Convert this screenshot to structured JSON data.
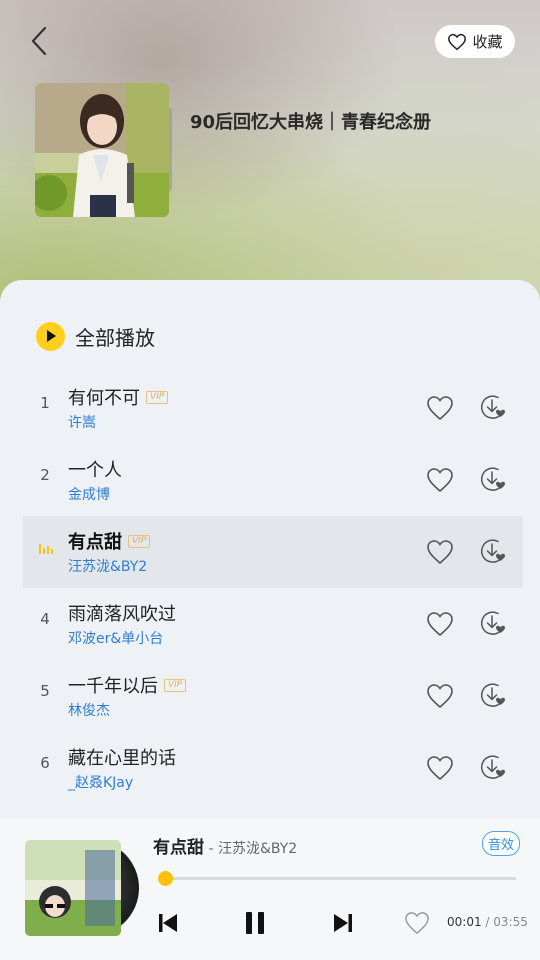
{
  "header": {
    "back_icon": "chevron-left-icon",
    "collect_label": "收藏",
    "collect_icon": "heart-outline-icon"
  },
  "playlist": {
    "title": "90后回忆大串烧｜青春纪念册"
  },
  "play_all": {
    "label": "全部播放",
    "icon": "play-circle-icon",
    "accent": "#ffcf1c"
  },
  "songs": [
    {
      "index": "1",
      "title": "有何不可",
      "vip": "VIP",
      "artist": "许嵩"
    },
    {
      "index": "2",
      "title": "一个人",
      "vip": "",
      "artist": "金成博"
    },
    {
      "index": "",
      "title": "有点甜",
      "vip": "VIP",
      "artist": "汪苏泷&BY2",
      "playing": true
    },
    {
      "index": "4",
      "title": "雨滴落风吹过",
      "vip": "",
      "artist": "邓波er&单小台"
    },
    {
      "index": "5",
      "title": "一千年以后",
      "vip": "VIP",
      "artist": "林俊杰"
    },
    {
      "index": "6",
      "title": "藏在心里的话",
      "vip": "",
      "artist": "_赵叒KJay"
    }
  ],
  "player": {
    "title": "有点甜",
    "artist": " - 汪苏泷&BY2",
    "sfx_label": "音效",
    "current_time": "00:01",
    "separator": " / ",
    "total_time": "03:55",
    "progress": 0.004,
    "artist_color": "#2d7fd3"
  }
}
